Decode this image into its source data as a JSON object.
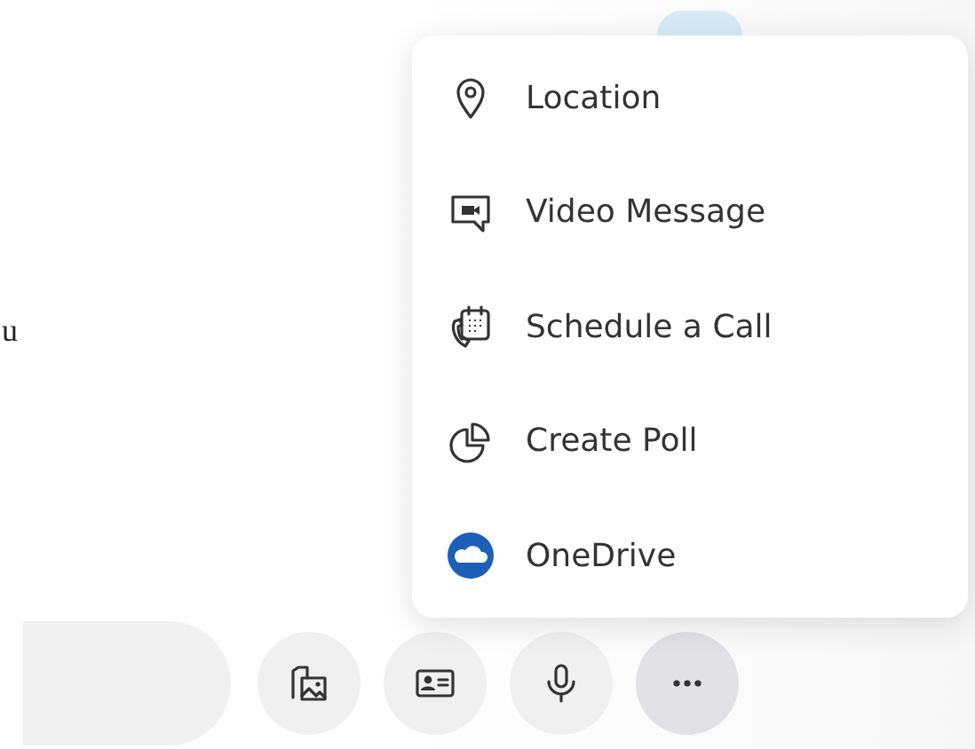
{
  "chat_text_fragment": "u",
  "menu": {
    "items": [
      {
        "label": "Location"
      },
      {
        "label": "Video Message"
      },
      {
        "label": "Schedule a Call"
      },
      {
        "label": "Create Poll"
      },
      {
        "label": "OneDrive"
      }
    ]
  },
  "toolbar": {
    "buttons": [
      {
        "selected": false
      },
      {
        "selected": false
      },
      {
        "selected": false
      },
      {
        "selected": true
      }
    ]
  }
}
